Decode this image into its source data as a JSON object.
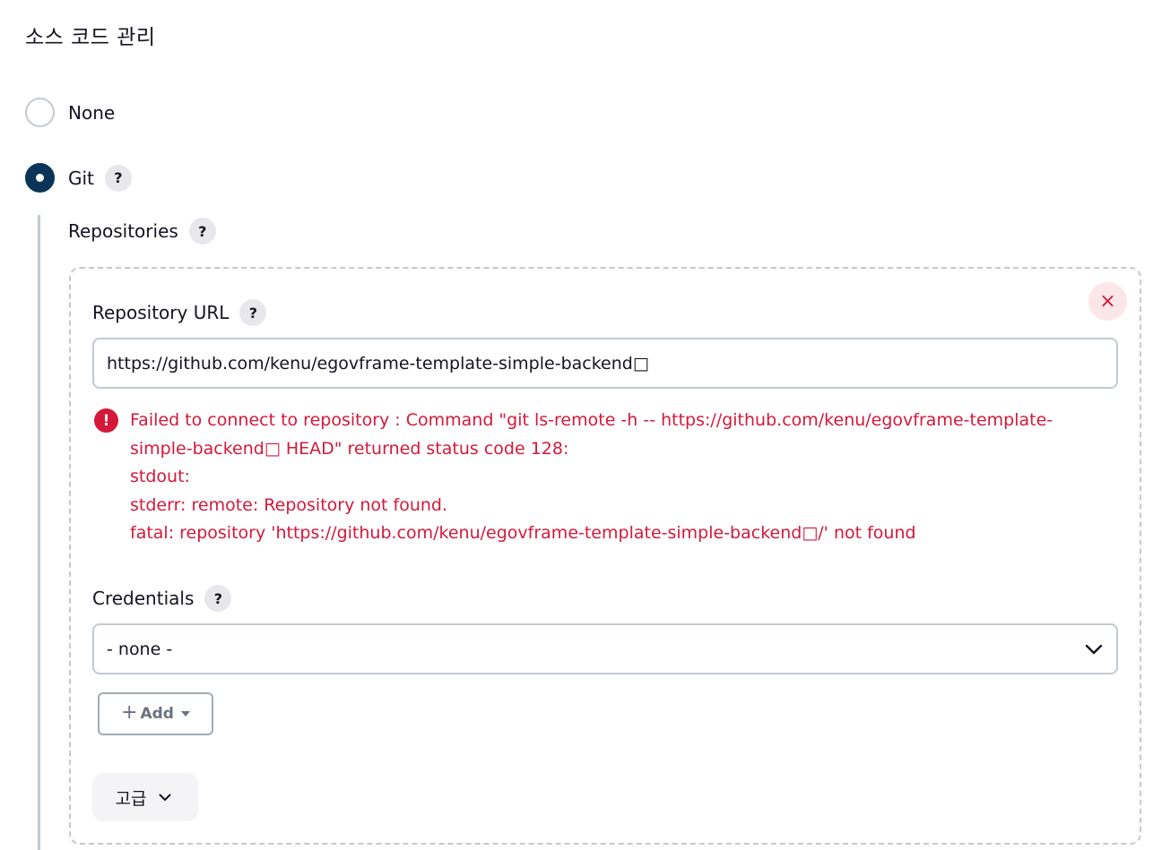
{
  "section": {
    "title": "소스 코드 관리"
  },
  "scm_options": [
    {
      "label": "None",
      "selected": false
    },
    {
      "label": "Git",
      "selected": true
    }
  ],
  "help": {
    "symbol": "?"
  },
  "repositories": {
    "label": "Repositories",
    "repository_url": {
      "label": "Repository URL",
      "value": "https://github.com/kenu/egovframe-template-simple-backend□"
    },
    "error": {
      "icon": "!",
      "lines": [
        "Failed to connect to repository : Command \"git ls-remote -h -- https://github.com/kenu/egovframe-template-",
        "simple-backend□ HEAD\" returned status code 128:",
        "stdout:",
        "stderr: remote: Repository not found.",
        "fatal: repository 'https://github.com/kenu/egovframe-template-simple-backend□/' not found"
      ]
    },
    "credentials": {
      "label": "Credentials",
      "selected": "- none -",
      "add_label": "Add"
    },
    "advanced_label": "고급",
    "delete_symbol": "×"
  },
  "colors": {
    "accent": "#0b3558",
    "error": "#d4193b",
    "border": "#c3c9d0"
  }
}
